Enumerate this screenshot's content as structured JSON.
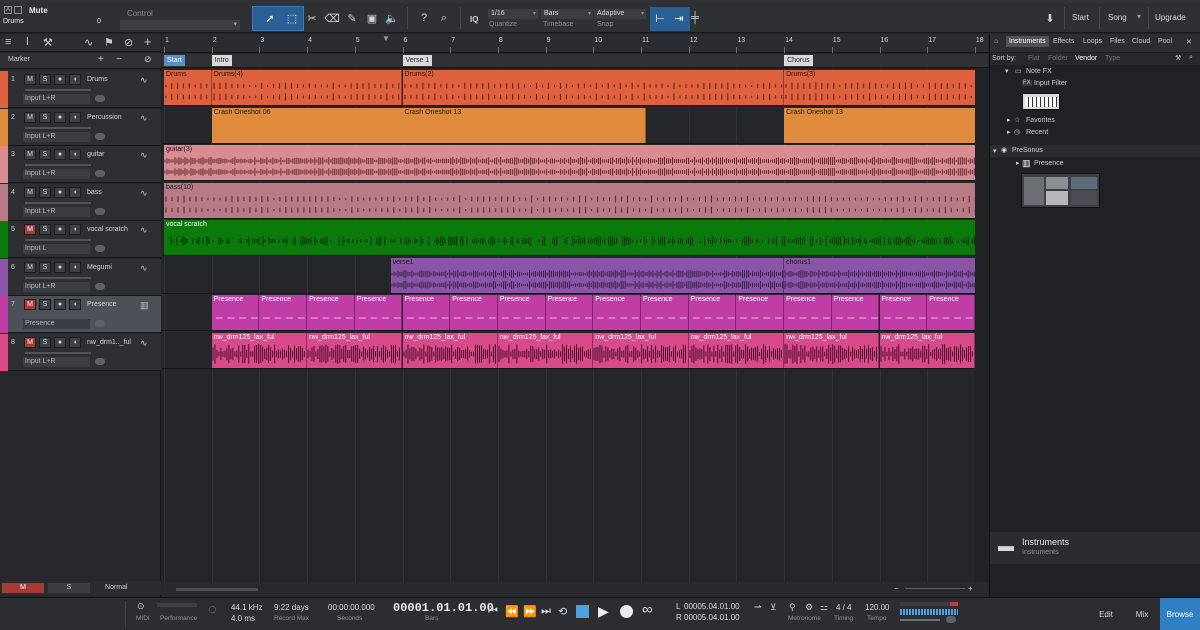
{
  "toolbar": {
    "track_name": "Drums",
    "mute_label": "Mute",
    "volume": "0",
    "control_label": "Control",
    "quantize_value": "1/16",
    "quantize_label": "Quantize",
    "timebase_value": "Bars",
    "timebase_label": "Timebase",
    "snap_value": "Adaptive",
    "snap_label": "Snap",
    "iq_label": "IQ",
    "start_label": "Start",
    "song_label": "Song",
    "upgrade_label": "Upgrade"
  },
  "tracklist": {
    "marker_label": "Marker",
    "tracks": [
      {
        "num": "1",
        "name": "Drums",
        "input": "Input L+R",
        "color": "#e0613f",
        "mute": false
      },
      {
        "num": "2",
        "name": "Percussion",
        "input": "Input L+R",
        "color": "#e08a3c",
        "mute": false
      },
      {
        "num": "3",
        "name": "guitar",
        "input": "Input L+R",
        "color": "#d98c92",
        "mute": false
      },
      {
        "num": "4",
        "name": "bass",
        "input": "Input L+R",
        "color": "#b87b86",
        "mute": false
      },
      {
        "num": "5",
        "name": "vocal scratch",
        "input": "Input L",
        "color": "#0a7a0a",
        "mute": true
      },
      {
        "num": "6",
        "name": "Megumi",
        "input": "Input L+R",
        "color": "#8a55a8",
        "mute": false
      },
      {
        "num": "7",
        "name": "Presence",
        "input": "Presence",
        "color": "#c03da8",
        "mute": true
      },
      {
        "num": "8",
        "name": "nw_drm1.._ful",
        "input": "Input L+R",
        "color": "#d94a8a",
        "mute": true
      }
    ],
    "footer_m": "M",
    "footer_s": "S",
    "footer_mode": "Normal"
  },
  "ruler": {
    "bars": [
      "1",
      "2",
      "3",
      "4",
      "5",
      "6",
      "7",
      "8",
      "9",
      "10",
      "11",
      "12",
      "13",
      "14",
      "15",
      "16",
      "17",
      "18"
    ]
  },
  "markers": [
    {
      "label": "Start",
      "bar": 1
    },
    {
      "label": "Intro",
      "bar": 2
    },
    {
      "label": "Verse 1",
      "bar": 6
    },
    {
      "label": "Chorus",
      "bar": 14
    }
  ],
  "clips": {
    "drums": [
      "Drums",
      "Drums(4)",
      "Drums(2)",
      "Drums(3)"
    ],
    "percussion": [
      "Crash Oneshot 06",
      "Crash Oneshot 13",
      "Crash Oneshot 13"
    ],
    "guitar": [
      "guitar(3)"
    ],
    "bass": [
      "bass(10)"
    ],
    "vocal": [
      "vocal scratch"
    ],
    "megumi": [
      "verse1",
      "chorus1"
    ],
    "presence_label": "Presence",
    "loop_label": "nw_drm125_lax_ful"
  },
  "browser": {
    "tabs": [
      "Instruments",
      "Effects",
      "Loops",
      "Files",
      "Cloud",
      "Pool"
    ],
    "sort_label": "Sort by:",
    "sort_options": [
      "Flat",
      "Folder",
      "Vendor",
      "Type"
    ],
    "note_fx": "Note FX",
    "input_filter": "Input Filter",
    "favorites": "Favorites",
    "recent": "Recent",
    "presonus": "PreSonus",
    "presence": "Presence",
    "footer_title": "Instruments",
    "footer_sub": "Instruments"
  },
  "transport": {
    "midi_label": "MIDI",
    "performance_label": "Performance",
    "sample_rate": "44.1 kHz",
    "latency": "4.0 ms",
    "record_max_value": "9:22 days",
    "record_max_label": "Record Max",
    "seconds_value": "00:00:00.000",
    "seconds_label": "Seconds",
    "position": "00001.01.01.00",
    "bars_label": "Bars",
    "loop_l": "00005.04.01.00",
    "loop_r": "00005.04.01.00",
    "l_label": "L",
    "r_label": "R",
    "metronome_label": "Metronome",
    "timing_value": "4 / 4",
    "timing_label": "Timing",
    "tempo_value": "120.00",
    "tempo_label": "Tempo",
    "edit_label": "Edit",
    "mix_label": "Mix",
    "browse_label": "Browse"
  }
}
